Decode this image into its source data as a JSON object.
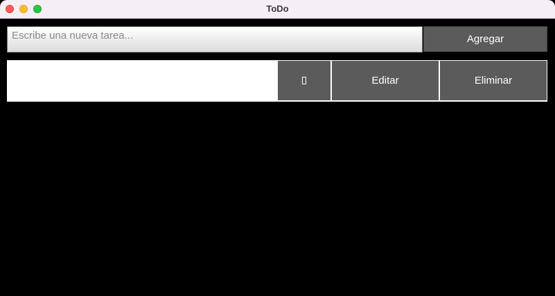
{
  "window": {
    "title": "ToDo"
  },
  "new_task": {
    "placeholder": "Escribe una nueva tarea...",
    "value": "",
    "add_label": "Agregar"
  },
  "tasks": [
    {
      "text": "",
      "complete_icon": "missing-glyph-icon",
      "edit_label": "Editar",
      "delete_label": "Eliminar"
    }
  ],
  "colors": {
    "button": "#5b5b5b",
    "background": "#000000",
    "titlebar": "#f6eef6"
  }
}
